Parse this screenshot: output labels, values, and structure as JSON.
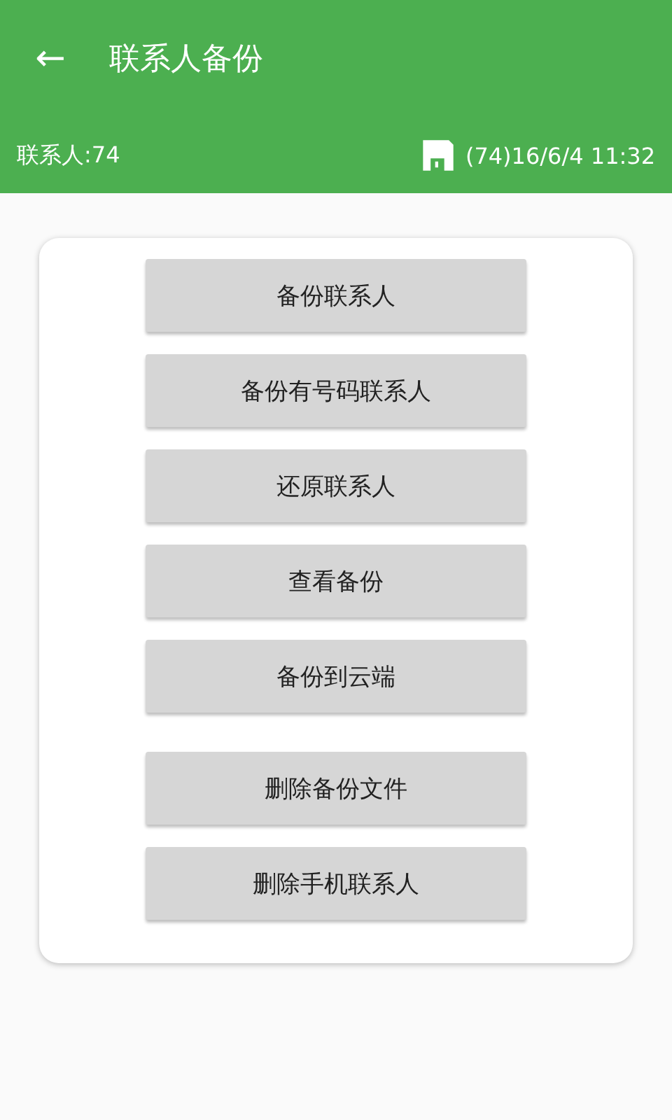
{
  "app_bar": {
    "back_icon": "←",
    "title": "联系人备份"
  },
  "info_bar": {
    "contacts": "联系人:74",
    "last_backup": "(74)16/6/4 11:32"
  },
  "button_groups": [
    [
      "备份联系人",
      "备份有号码联系人",
      "还原联系人",
      "查看备份",
      "备份到云端"
    ],
    [
      "删除备份文件",
      "删除手机联系人"
    ]
  ]
}
